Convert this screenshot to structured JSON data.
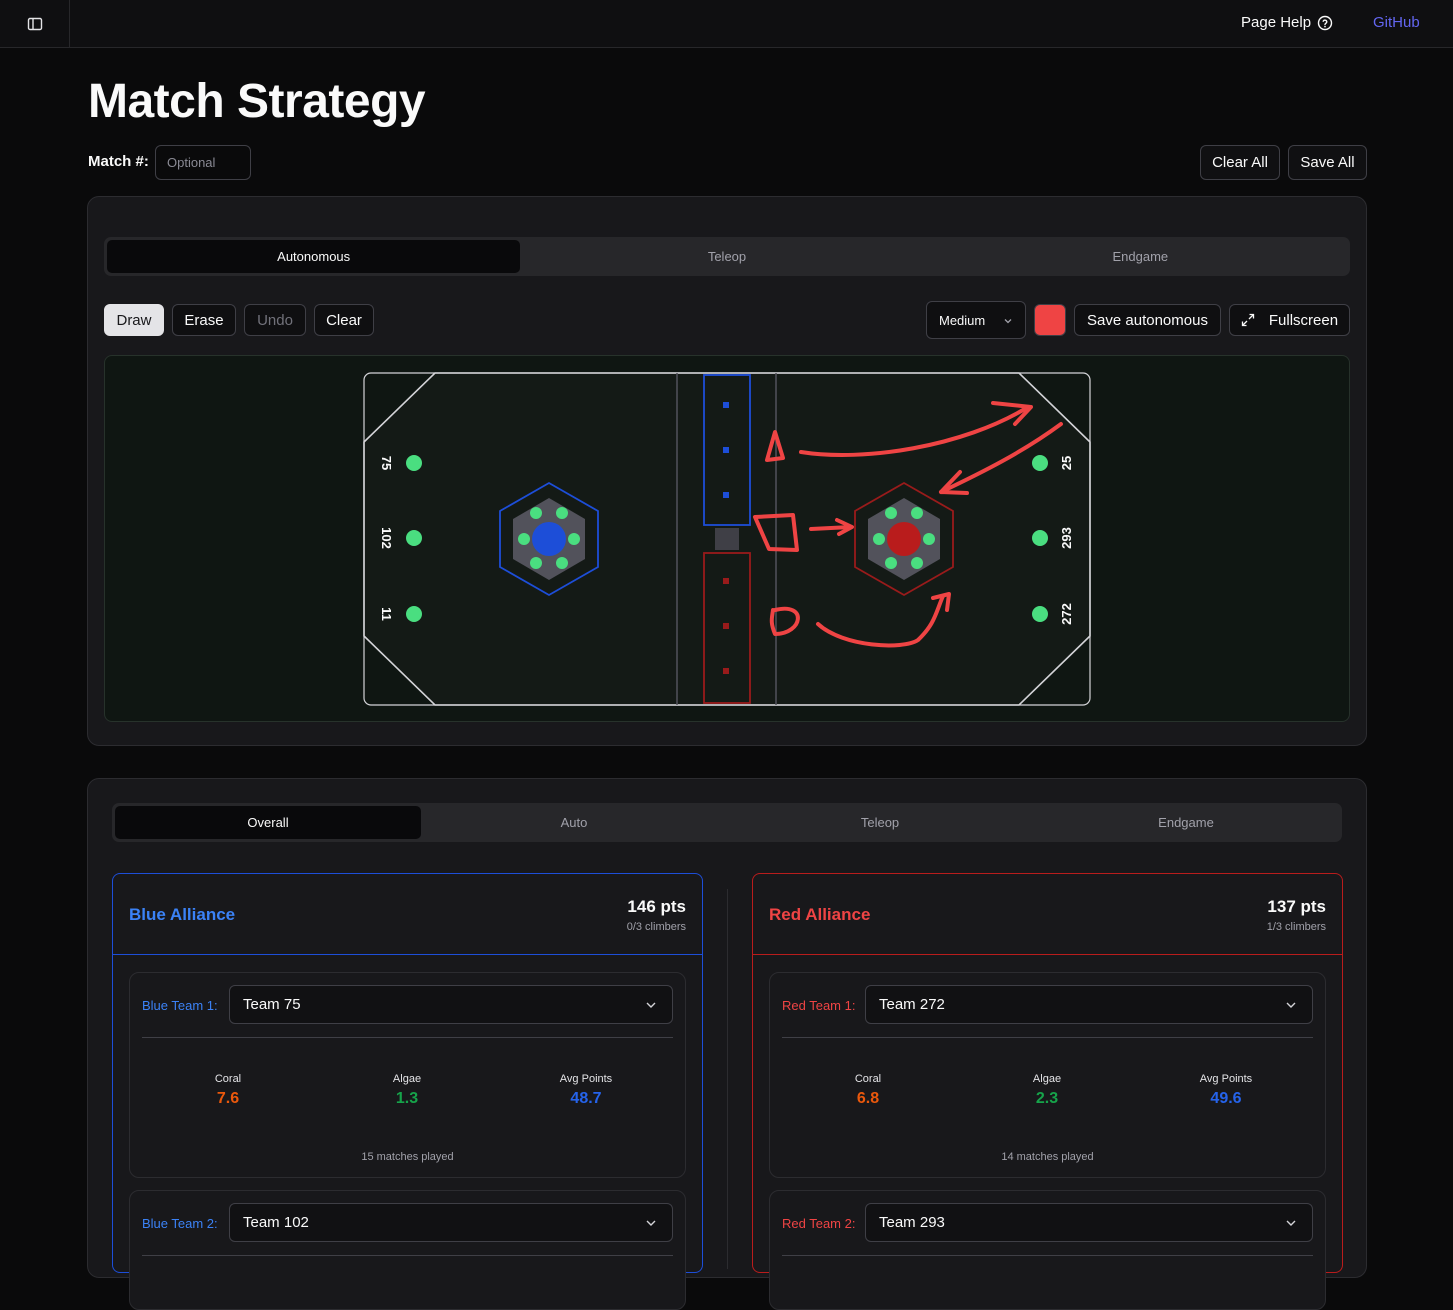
{
  "header": {
    "page_help": "Page Help",
    "github": "GitHub"
  },
  "page": {
    "title": "Match Strategy",
    "match_label": "Match #:",
    "match_placeholder": "Optional",
    "match_value": "",
    "clear_all": "Clear All",
    "save_all": "Save All"
  },
  "field_panel": {
    "tabs": [
      "Autonomous",
      "Teleop",
      "Endgame"
    ],
    "active_tab": 0,
    "tools": {
      "draw": "Draw",
      "erase": "Erase",
      "undo": "Undo",
      "clear": "Clear"
    },
    "brush_size": "Medium",
    "brush_color": "#ef4444",
    "save_label": "Save autonomous",
    "fullscreen_label": "Fullscreen",
    "blue_stations": [
      "75",
      "102",
      "11"
    ],
    "red_stations": [
      "25",
      "293",
      "272"
    ]
  },
  "stats_panel": {
    "tabs": [
      "Overall",
      "Auto",
      "Teleop",
      "Endgame"
    ],
    "active_tab": 0,
    "stat_labels": {
      "coral": "Coral",
      "algae": "Algae",
      "avg": "Avg Points"
    },
    "blue": {
      "name": "Blue Alliance",
      "points": "146 pts",
      "climbers": "0/3 climbers",
      "teams": [
        {
          "label": "Blue Team 1:",
          "team": "Team 75",
          "coral": "7.6",
          "algae": "1.3",
          "avg": "48.7",
          "played": "15 matches played"
        },
        {
          "label": "Blue Team 2:",
          "team": "Team 102"
        }
      ]
    },
    "red": {
      "name": "Red Alliance",
      "points": "137 pts",
      "climbers": "1/3 climbers",
      "teams": [
        {
          "label": "Red Team 1:",
          "team": "Team 272",
          "coral": "6.8",
          "algae": "2.3",
          "avg": "49.6",
          "played": "14 matches played"
        },
        {
          "label": "Red Team 2:",
          "team": "Team 293"
        }
      ]
    }
  },
  "colors": {
    "blue_accent": "#3b82f6",
    "red_accent": "#ef4444",
    "link": "#6366f1",
    "coral": "#ea580c",
    "algae": "#16a34a",
    "avg_points": "#2563eb"
  }
}
